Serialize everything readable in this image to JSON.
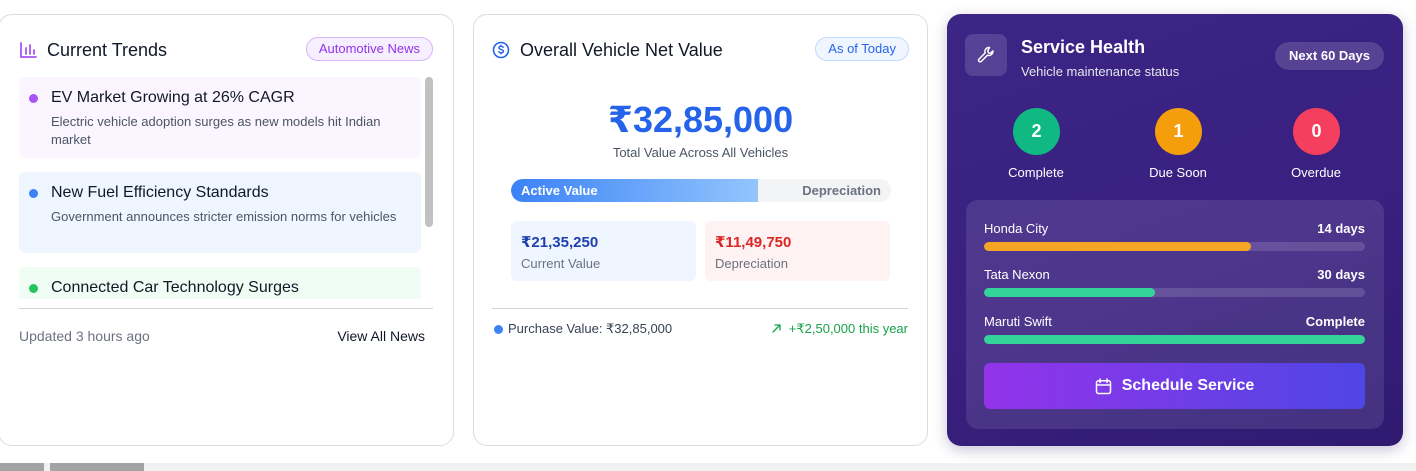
{
  "trends": {
    "title": "Current Trends",
    "badge": "Automotive News",
    "icon": "bar-chart-icon",
    "accent": "#a855f7",
    "items": [
      {
        "title": "EV Market Growing at 26% CAGR",
        "desc": "Electric vehicle adoption surges as new models hit Indian market",
        "dot_color": "#a855f7",
        "bg": "#faf5ff"
      },
      {
        "title": "New Fuel Efficiency Standards",
        "desc": "Government announces stricter emission norms for vehicles",
        "dot_color": "#3b82f6",
        "bg": "#eff6ff"
      },
      {
        "title": "Connected Car Technology Surges",
        "desc": "",
        "dot_color": "#22c55e",
        "bg": "#f0fdf4"
      }
    ],
    "updated": "Updated 3 hours ago",
    "view_all": "View All News"
  },
  "net_value": {
    "title": "Overall Vehicle Net Value",
    "icon": "dollar-circle-icon",
    "badge": "As of Today",
    "total": "₹32,85,000",
    "total_label": "Total Value Across All Vehicles",
    "bar_active_label": "Active Value",
    "bar_depreciation_label": "Depreciation",
    "active_fraction": 0.65,
    "current_value": "₹21,35,250",
    "current_label": "Current Value",
    "depreciation_value": "₹11,49,750",
    "depreciation_label": "Depreciation",
    "purchase": "Purchase Value: ₹32,85,000",
    "gain": "+₹2,50,000 this year",
    "colors": {
      "blue": "#2563eb",
      "red": "#dc2626",
      "green": "#16a34a"
    }
  },
  "service": {
    "title": "Service Health",
    "subtitle": "Vehicle maintenance status",
    "icon": "wrench-icon",
    "badge": "Next 60 Days",
    "stats": [
      {
        "value": "2",
        "label": "Complete",
        "color": "#10b981"
      },
      {
        "value": "1",
        "label": "Due Soon",
        "color": "#f59e0b"
      },
      {
        "value": "0",
        "label": "Overdue",
        "color": "#f43f5e"
      }
    ],
    "vehicles": [
      {
        "name": "Honda City",
        "status": "14 days",
        "progress": 0.7,
        "color": "#f5a623"
      },
      {
        "name": "Tata Nexon",
        "status": "30 days",
        "progress": 0.45,
        "color": "#34d399"
      },
      {
        "name": "Maruti Swift",
        "status": "Complete",
        "progress": 1.0,
        "color": "#34d399"
      }
    ],
    "button": "Schedule Service",
    "button_icon": "calendar-icon"
  }
}
